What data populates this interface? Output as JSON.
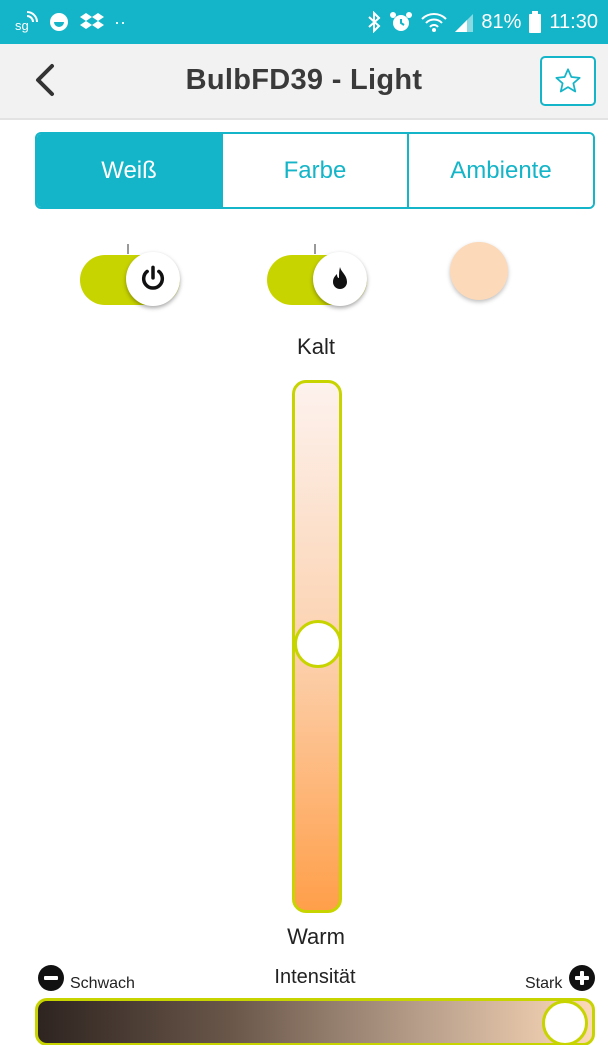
{
  "status_bar": {
    "battery": "81%",
    "time": "11:30",
    "more": "··"
  },
  "app_bar": {
    "title": "BulbFD39 - Light",
    "star_glyph": "☆"
  },
  "tabs": [
    {
      "label": "Weiß",
      "active": true
    },
    {
      "label": "Farbe",
      "active": false
    },
    {
      "label": "Ambiente",
      "active": false
    }
  ],
  "toggles": {
    "power": {
      "on": true
    },
    "white_mode": {
      "on": true
    }
  },
  "temperature": {
    "top_label": "Kalt",
    "bottom_label": "Warm",
    "position": 0.5
  },
  "intensity": {
    "label": "Intensität",
    "min_label": "Schwach",
    "max_label": "Stark",
    "value": 1.0
  },
  "colors": {
    "accent": "#14b5c8",
    "lime": "#c8d400",
    "preview": "#fcd9b8"
  },
  "icons": {
    "back": "chevron-left-icon",
    "favorite": "star-outline-icon",
    "power": "power-icon",
    "flame": "flame-icon",
    "minus": "minus-circle-icon",
    "plus": "plus-circle-icon"
  }
}
